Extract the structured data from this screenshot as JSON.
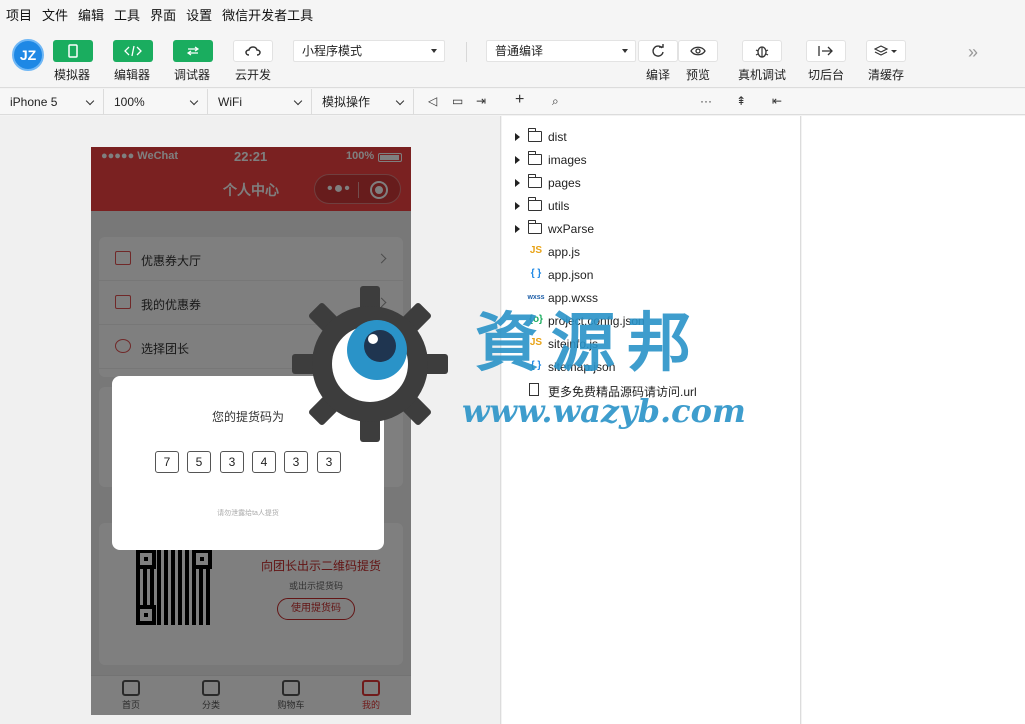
{
  "menubar": [
    "项目",
    "文件",
    "编辑",
    "工具",
    "界面",
    "设置",
    "微信开发者工具"
  ],
  "toolbar": {
    "simulator": "模拟器",
    "editor": "编辑器",
    "debugger": "调试器",
    "cloud": "云开发",
    "mode_select": "小程序模式",
    "compile_select": "普通编译",
    "compile": "编译",
    "preview": "预览",
    "real_debug": "真机调试",
    "background": "切后台",
    "clear_cache": "清缓存"
  },
  "subbar": {
    "device": "iPhone 5",
    "zoom": "100%",
    "network": "WiFi",
    "operation": "模拟操作"
  },
  "phone": {
    "status_carrier": "●●●●● WeChat",
    "status_time": "22:21",
    "status_battery": "100%",
    "nav_title": "个人中心",
    "menu_items": [
      "优惠券大厅",
      "我的优惠券",
      "选择团长"
    ],
    "qr_note1": "向团长出示二维码提货",
    "qr_note2": "或出示提货码",
    "qr_button": "使用提货码",
    "tabs": [
      "首页",
      "分类",
      "购物车",
      "我的"
    ]
  },
  "dialog": {
    "title": "您的提货码为",
    "close": "×",
    "code": [
      "7",
      "5",
      "3",
      "4",
      "3",
      "3"
    ],
    "hint": "请勿泄露给ta人提货"
  },
  "filetree": {
    "folders": [
      "dist",
      "images",
      "pages",
      "utils",
      "wxParse"
    ],
    "files": [
      {
        "type": "JS",
        "name": "app.js"
      },
      {
        "type": "{ }",
        "name": "app.json"
      },
      {
        "type": "wxss",
        "name": "app.wxss"
      },
      {
        "type": "{o}",
        "name": "project.config.json"
      },
      {
        "type": "JS",
        "name": "siteinfo.js"
      },
      {
        "type": "{ }",
        "name": "sitemap.json"
      },
      {
        "type": "doc",
        "name": "更多免费精品源码请访问.url"
      }
    ]
  },
  "watermark": {
    "title": "資源邦",
    "url": "www.wazyb.com"
  },
  "colors": {
    "accent_green": "#1aad5f",
    "nav_red": "#f44343",
    "watermark_blue": "#2a93c8"
  }
}
